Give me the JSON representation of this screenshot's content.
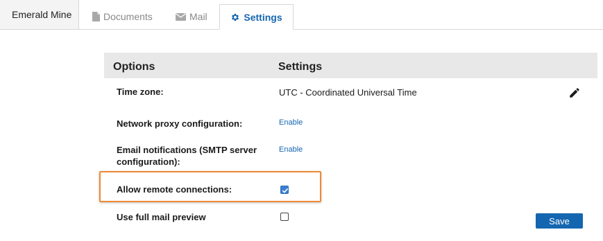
{
  "tabs": {
    "brand": "Emerald Mine",
    "documents": "Documents",
    "mail": "Mail",
    "settings": "Settings",
    "active": "settings"
  },
  "table": {
    "header_options": "Options",
    "header_settings": "Settings"
  },
  "rows": {
    "timezone": {
      "label": "Time zone:",
      "value": "UTC - Coordinated Universal Time"
    },
    "proxy": {
      "label": "Network proxy configuration:",
      "link": "Enable"
    },
    "email": {
      "label": "Email notifications (SMTP server configuration):",
      "link": "Enable"
    },
    "remote": {
      "label": "Allow remote connections:",
      "checked": true
    },
    "preview": {
      "label": "Use full mail preview",
      "checked": false
    }
  },
  "actions": {
    "save": "Save"
  },
  "colors": {
    "accent": "#1566b0",
    "highlight": "#ee8a34",
    "header_bg": "#e8e8e8"
  },
  "icons": {
    "documents": "document-icon",
    "mail": "envelope-icon",
    "settings": "gear-icon",
    "edit": "pencil-icon"
  }
}
